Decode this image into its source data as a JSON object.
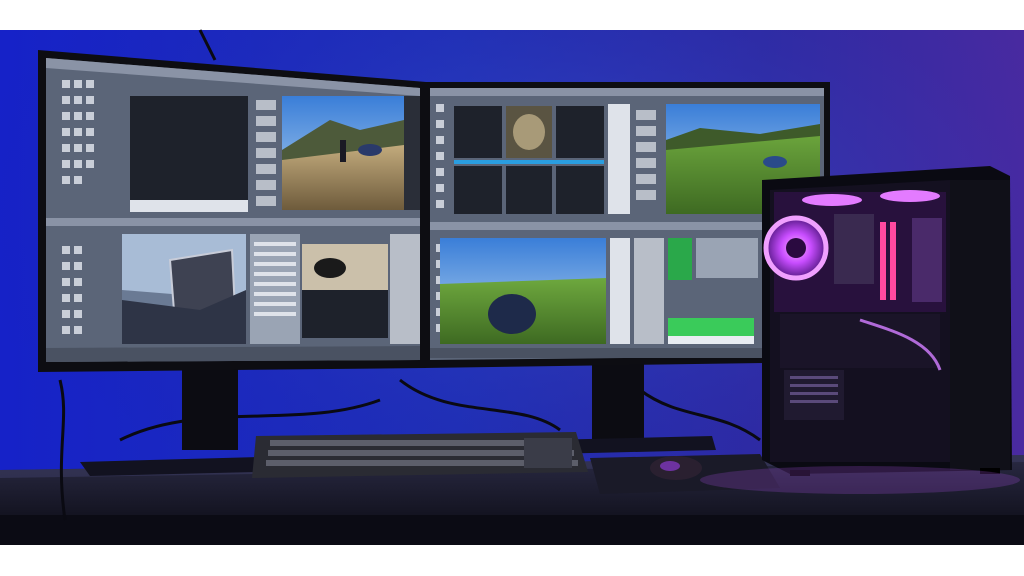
{
  "scene": {
    "description_tag": "dual-monitor-desk-setup",
    "colors": {
      "wall_left": "#1b1fb8",
      "wall_right": "#3d2aa8",
      "desk": "#1a1a2a",
      "monitor_bezel": "#0d0d12",
      "screen_ui_bg": "#5b6578",
      "panel_dark": "#1e222b",
      "pc_glow": "#c84dff",
      "pc_fan_ring": "#e37bff",
      "keyboard": "#2a2b33"
    }
  }
}
